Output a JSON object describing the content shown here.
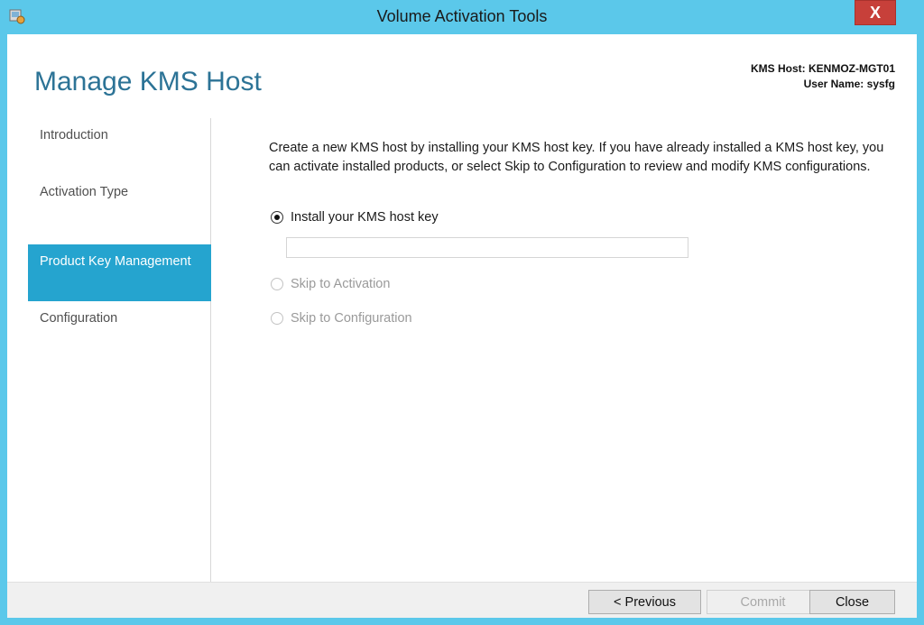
{
  "window": {
    "title": "Volume Activation Tools",
    "close_glyph": "X"
  },
  "header": {
    "page_title": "Manage KMS Host",
    "kms_host_line": "KMS Host: KENMOZ-MGT01",
    "user_name_line": "User Name: sysfg"
  },
  "nav": {
    "items": [
      {
        "label": "Introduction",
        "active": false
      },
      {
        "label": "Activation Type",
        "active": false
      },
      {
        "label": "Product Key Management",
        "active": true
      },
      {
        "label": "Configuration",
        "active": false
      }
    ]
  },
  "main": {
    "description": "Create a new KMS host by installing your KMS host key. If you have already installed a KMS host key, you can activate installed products, or select Skip to Configuration to review and modify KMS configurations.",
    "options": [
      {
        "label": "Install your KMS host key",
        "checked": true,
        "enabled": true
      },
      {
        "label": "Skip to Activation",
        "checked": false,
        "enabled": false
      },
      {
        "label": "Skip to Configuration",
        "checked": false,
        "enabled": false
      }
    ],
    "key_input": {
      "value": "",
      "placeholder": ""
    }
  },
  "footer": {
    "previous_label": "< Previous",
    "commit_label": "Commit",
    "close_label": "Close"
  },
  "colors": {
    "window_frame": "#5bc8ea",
    "accent": "#25a4cf",
    "title_text": "#2c7396",
    "close_button": "#c7403a"
  },
  "icons": {
    "app": "volume-activation-app-icon",
    "close": "close-icon"
  }
}
